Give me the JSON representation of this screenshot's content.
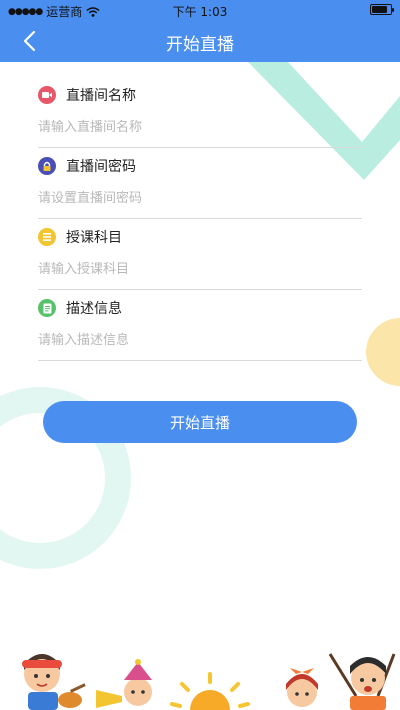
{
  "status_bar": {
    "carrier": "运营商",
    "time": "下午 1:03",
    "battery_level": 0.85
  },
  "nav": {
    "title": "开始直播",
    "back_icon": "chevron-left-icon"
  },
  "colors": {
    "primary": "#4a8ef0",
    "mint": "#b8ede0",
    "yellow": "#fbe5a8"
  },
  "form": {
    "fields": [
      {
        "label": "直播间名称",
        "placeholder": "请输入直播间名称",
        "value": "",
        "icon": "video-icon",
        "icon_color": "#e8566a"
      },
      {
        "label": "直播间密码",
        "placeholder": "请设置直播间密码",
        "value": "",
        "icon": "lock-icon",
        "icon_color": "#4a4fb5"
      },
      {
        "label": "授课科目",
        "placeholder": "请输入授课科目",
        "value": "",
        "icon": "list-icon",
        "icon_color": "#f2c531"
      },
      {
        "label": "描述信息",
        "placeholder": "请输入描述信息",
        "value": "",
        "icon": "document-icon",
        "icon_color": "#57c26b"
      }
    ]
  },
  "actions": {
    "start_label": "开始直播"
  },
  "decoration": {
    "illustration": "cartoon-children-illustration"
  }
}
